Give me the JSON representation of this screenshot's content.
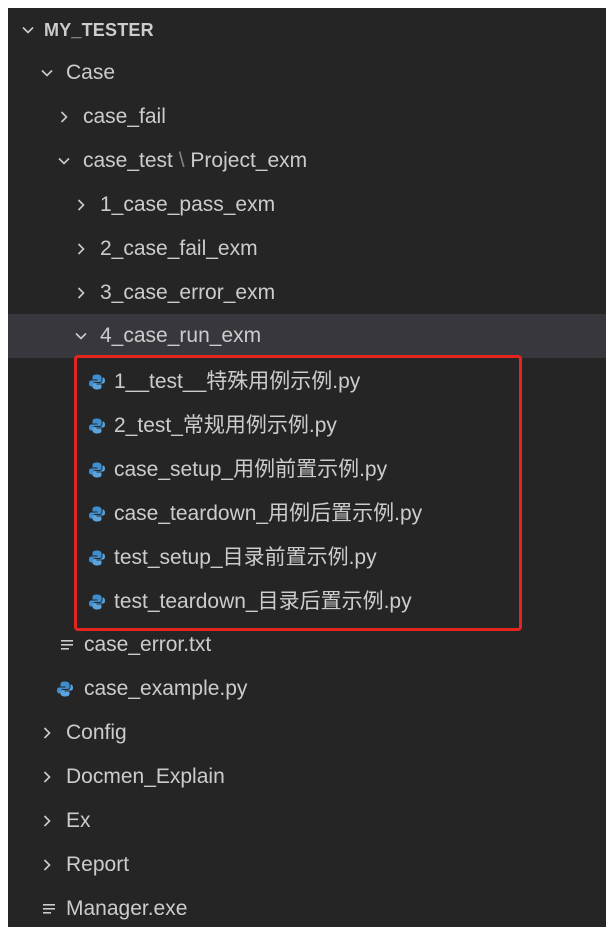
{
  "explorer": {
    "root_label": "MY_TESTER",
    "items": [
      {
        "label": "Case"
      },
      {
        "label": "case_fail"
      },
      {
        "label": "case_test",
        "separator": "\\",
        "label_suffix": "Project_exm"
      },
      {
        "label": "1_case_pass_exm"
      },
      {
        "label": "2_case_fail_exm"
      },
      {
        "label": "3_case_error_exm"
      },
      {
        "label": "4_case_run_exm"
      },
      {
        "label": "1__test__特殊用例示例.py"
      },
      {
        "label": "2_test_常规用例示例.py"
      },
      {
        "label": "case_setup_用例前置示例.py"
      },
      {
        "label": "case_teardown_用例后置示例.py"
      },
      {
        "label": "test_setup_目录前置示例.py"
      },
      {
        "label": "test_teardown_目录后置示例.py"
      },
      {
        "label": "case_error.txt"
      },
      {
        "label": "case_example.py"
      },
      {
        "label": "Config"
      },
      {
        "label": "Docmen_Explain"
      },
      {
        "label": "Ex"
      },
      {
        "label": "Report"
      },
      {
        "label": "Manager.exe"
      }
    ]
  },
  "colors": {
    "background": "#252526",
    "selected_row": "#37373d",
    "text": "#cccccc",
    "python_icon": "#3f8fd0",
    "highlight_border": "#e3241f"
  },
  "icons": {
    "folder_collapsed": "chevron-right-icon",
    "folder_expanded": "chevron-down-icon",
    "python_file": "python-file-icon",
    "text_file": "text-file-icon"
  }
}
